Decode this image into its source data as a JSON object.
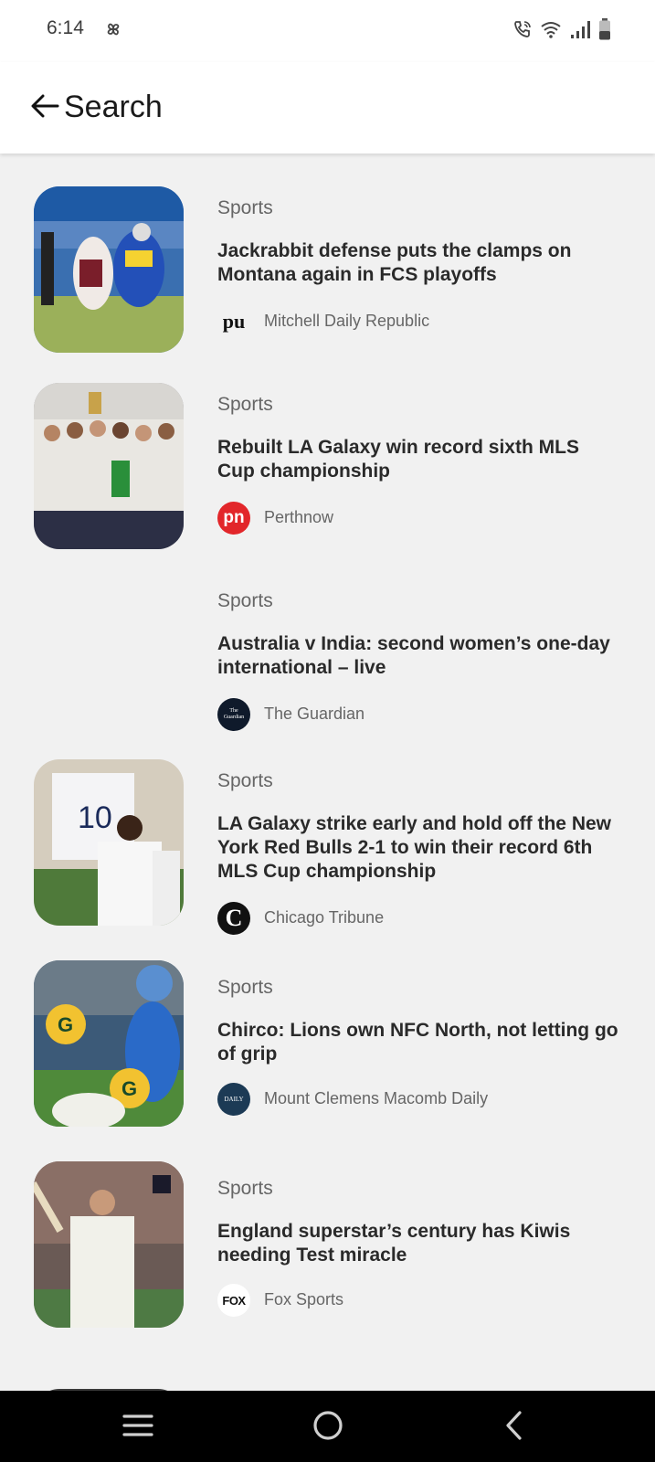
{
  "status_bar": {
    "time": "6:14"
  },
  "header": {
    "title": "Search"
  },
  "articles": [
    {
      "category": "Sports",
      "headline": "Jackrabbit defense puts the clamps on Montana again in FCS playoffs",
      "source": "Mitchell Daily Republic",
      "logo_text": "pu",
      "has_image": true
    },
    {
      "category": "Sports",
      "headline": "Rebuilt LA Galaxy win record sixth MLS Cup championship",
      "source": "Perthnow",
      "logo_text": "pn",
      "has_image": true
    },
    {
      "category": "Sports",
      "headline": "Australia v India: second women’s one-day international – live",
      "source": "The Guardian",
      "logo_text": "The Guardian",
      "has_image": false
    },
    {
      "category": "Sports",
      "headline": "LA Galaxy strike early and hold off the New York Red Bulls 2-1 to win their record 6th MLS Cup championship",
      "source": "Chicago Tribune",
      "logo_text": "C",
      "has_image": true
    },
    {
      "category": "Sports",
      "headline": "Chirco: Lions own NFC North, not letting go of grip",
      "source": "Mount Clemens Macomb Daily",
      "logo_text": "DAILY",
      "has_image": true
    },
    {
      "category": "Sports",
      "headline": "England superstar’s century has Kiwis needing Test miracle",
      "source": "Fox Sports",
      "logo_text": "FOX",
      "has_image": true
    }
  ],
  "colors": {
    "background": "#f1f1f1",
    "perthnow_red": "#e2262a",
    "nav_bar": "#000000"
  }
}
